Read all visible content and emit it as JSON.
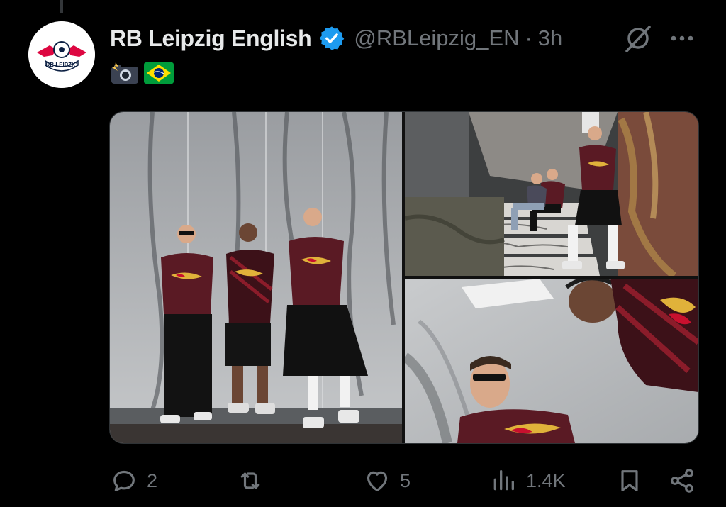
{
  "tweet": {
    "display_name": "RB Leipzig English",
    "handle": "@RBLeipzig_EN",
    "separator": "·",
    "time": "3h",
    "avatar_text": "RB LEIPZIG",
    "emojis": [
      "camera-flash-emoji",
      "brazil-flag-emoji"
    ],
    "verified": true
  },
  "media": {
    "images": [
      {
        "name": "three-players-concrete-wall"
      },
      {
        "name": "players-on-graffiti-stairs"
      },
      {
        "name": "low-angle-two-players"
      }
    ]
  },
  "actions": {
    "reply_count": "2",
    "retweet_count": "",
    "like_count": "5",
    "views_count": "1.4K"
  },
  "colors": {
    "background": "#000000",
    "text_primary": "#e7e9ea",
    "text_secondary": "#71767b",
    "verified_blue": "#1d9bf0",
    "jersey_red": "#5a1a24"
  }
}
